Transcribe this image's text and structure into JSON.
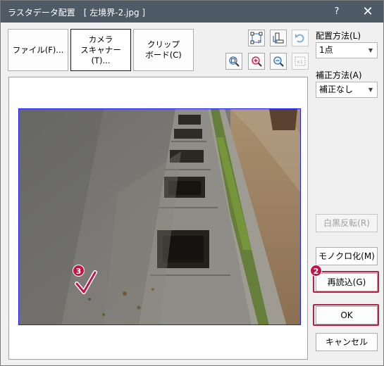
{
  "window": {
    "title": "ラスタデータ配置　[ 左境界-2.jpg ]",
    "help_label": "?",
    "close_label": "✕"
  },
  "source_buttons": [
    {
      "label": "ファイル(F)..."
    },
    {
      "label": "カメラ\nスキャナー(T)..."
    },
    {
      "label": "クリップ\nボード(C)"
    }
  ],
  "placement": {
    "label": "配置方法(L)",
    "value": "1点"
  },
  "correction": {
    "label": "補正方法(A)",
    "value": "補正なし"
  },
  "buttons": {
    "invert": "白黒反転(R)",
    "mono": "モノクロ化(M)",
    "reload": "再読込(G)",
    "ok": "OK",
    "cancel": "キャンセル"
  },
  "badges": {
    "reload_step": "2",
    "check_step": "3"
  },
  "toolbar_icons": [
    "point-placement-icon",
    "rotate-icon",
    "undo-icon",
    "zoom-fit-icon",
    "zoom-in-icon",
    "zoom-out-icon",
    "zoom-actual-icon"
  ],
  "colors": {
    "titlebar": "#4e5a66",
    "highlight": "#b3234a",
    "badge": "#c0144b",
    "image_border": "#1a1aff",
    "accent_icon": "#2a6ebb"
  }
}
